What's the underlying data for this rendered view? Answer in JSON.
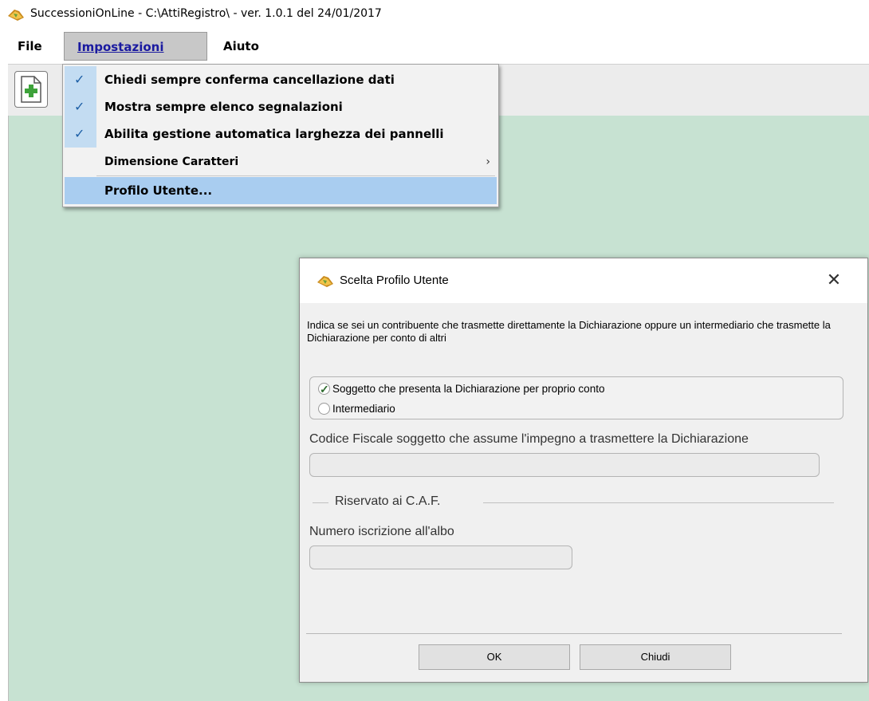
{
  "window": {
    "title": "SuccessioniOnLine - C:\\AttiRegistro\\  -  ver. 1.0.1 del 24/01/2017"
  },
  "menubar": {
    "file": "File",
    "impostazioni": "Impostazioni",
    "aiuto": "Aiuto"
  },
  "dropdown": {
    "items": [
      {
        "label": "Chiedi sempre conferma cancellazione dati",
        "checked": true
      },
      {
        "label": "Mostra sempre elenco segnalazioni",
        "checked": true
      },
      {
        "label": "Abilita gestione automatica larghezza dei pannelli",
        "checked": true
      },
      {
        "label": "Dimensione Caratteri",
        "submenu": true
      },
      {
        "label": "Profilo Utente...",
        "highlighted": true
      }
    ]
  },
  "dialog": {
    "title": "Scelta Profilo Utente",
    "close_glyph": "✕",
    "description": "Indica se sei un contribuente che trasmette direttamente la Dichiarazione oppure un intermediario che trasmette la Dichiarazione per conto di altri",
    "radio_options": [
      {
        "label": "Soggetto che presenta la Dichiarazione per proprio conto",
        "selected": true
      },
      {
        "label": "Intermediario",
        "selected": false
      }
    ],
    "codice_label": "Codice Fiscale soggetto che assume l'impegno a trasmettere la Dichiarazione",
    "codice_value": "",
    "caf_group_label": "Riservato ai C.A.F.",
    "albo_label": "Numero iscrizione all'albo",
    "albo_value": "",
    "ok_label": "OK",
    "chiudi_label": "Chiudi"
  },
  "colors": {
    "workspace": "#c7e2d2",
    "menu_highlight": "#a9cdf0",
    "check": "#1d5fa6"
  }
}
